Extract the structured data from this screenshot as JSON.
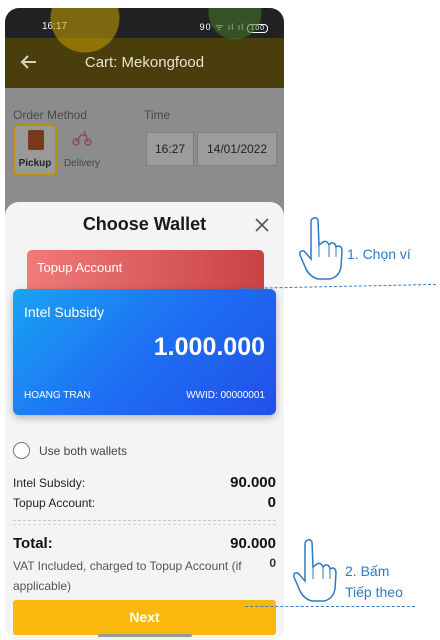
{
  "status_bar": {
    "time": "16:17",
    "icons": "90 ᯤ ıl ıl",
    "battery": "100"
  },
  "header": {
    "title": "Cart: Mekongfood"
  },
  "order": {
    "method_label": "Order Method",
    "time_label": "Time",
    "pickup_label": "Pickup",
    "delivery_label": "Delivery",
    "time_value": "16:27",
    "date_value": "14/01/2022"
  },
  "sheet": {
    "title": "Choose Wallet",
    "topup_card_label": "Topup Account",
    "subsidy_card": {
      "name": "Intel Subsidy",
      "amount": "1.000.000",
      "holder": "HOANG TRAN",
      "wwid": "WWID: 00000001"
    },
    "use_both_label": "Use both wallets",
    "breakdown": [
      {
        "label": "Intel Subsidy:",
        "value": "90.000"
      },
      {
        "label": "Topup Account:",
        "value": "0"
      }
    ],
    "total_label": "Total:",
    "total_value": "90.000",
    "vat_note": "VAT Included, charged to Topup Account (if applicable)",
    "vat_value": "0",
    "next_label": "Next"
  },
  "annotations": {
    "step1": "1. Chọn ví",
    "step2_line1": "2. Bấm",
    "step2_line2": "Tiếp theo"
  },
  "colors": {
    "accent_button": "#fbb80c",
    "topup_card": "#d9585c",
    "subsidy_card": "#1e6ff3",
    "annotation": "#2e79c4"
  }
}
